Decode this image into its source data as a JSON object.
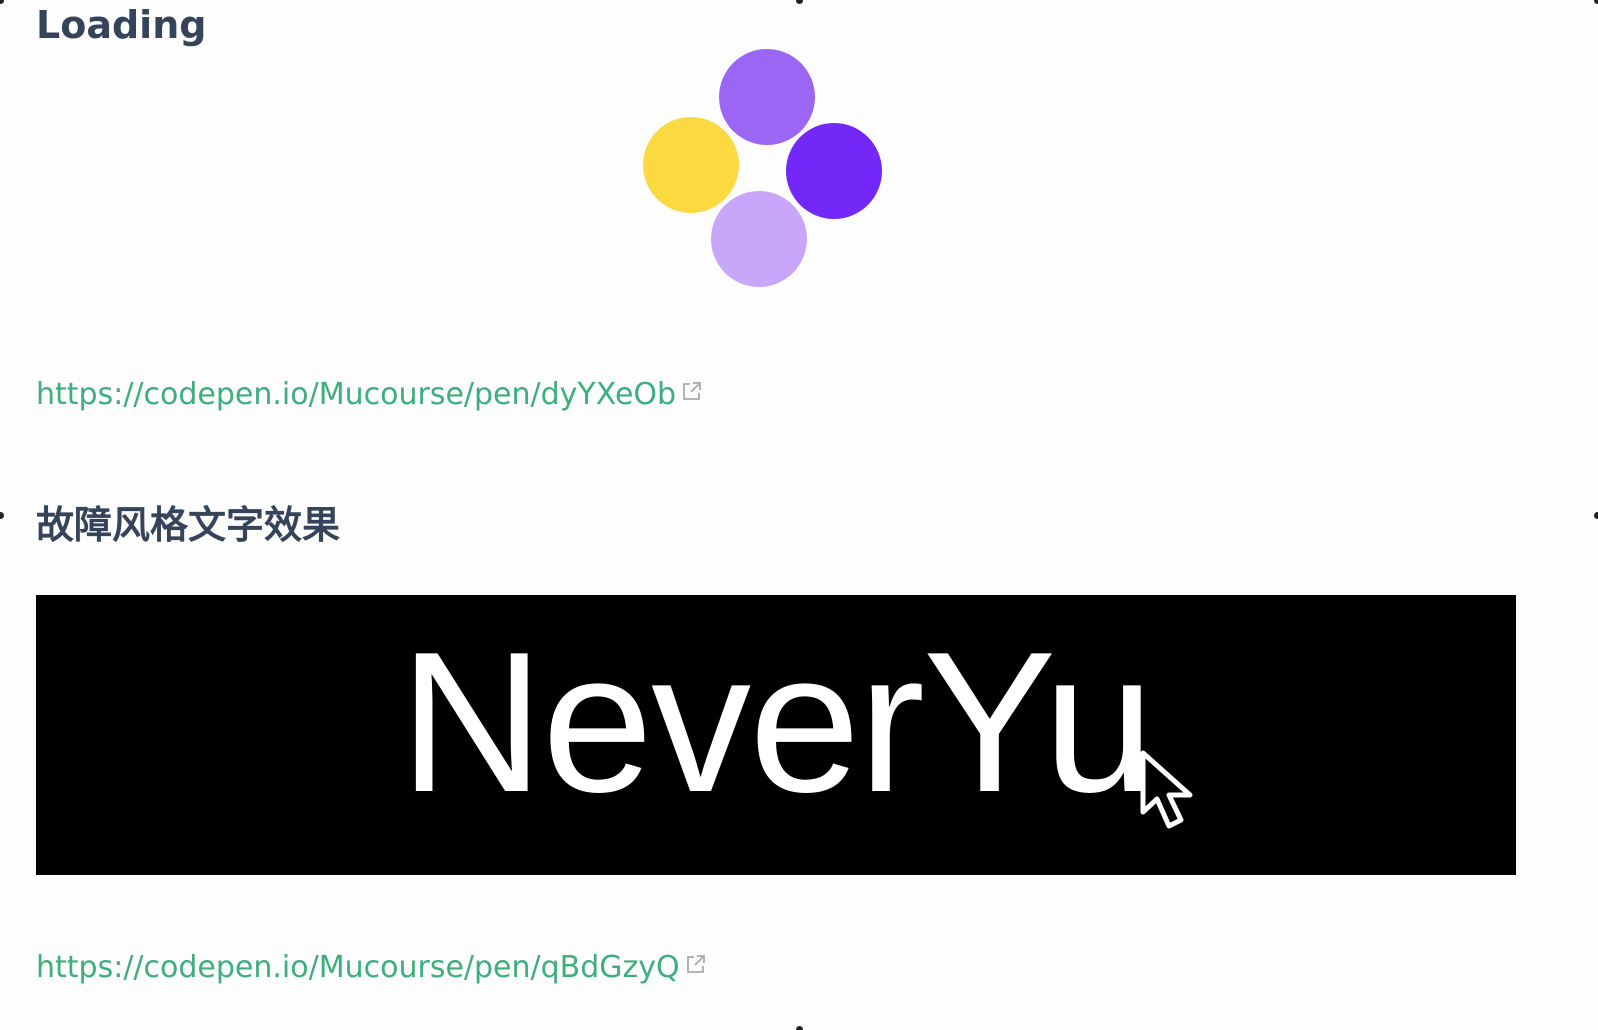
{
  "sections": [
    {
      "title": "Loading",
      "link": "https://codepen.io/Mucourse/pen/dyYXeOb",
      "loader": {
        "dots": [
          {
            "position": "top",
            "color": "#9c66f5"
          },
          {
            "position": "left",
            "color": "#fcd940"
          },
          {
            "position": "right",
            "color": "#7428f7"
          },
          {
            "position": "bottom",
            "color": "#c8a6fa"
          }
        ]
      }
    },
    {
      "title": "故障风格文字效果",
      "link": "https://codepen.io/Mucourse/pen/qBdGzyQ",
      "demo_text": "NeverYu"
    }
  ],
  "colors": {
    "heading": "#36445b",
    "link": "#3eaf7c",
    "external_icon": "#aaaaaa",
    "demo_background": "#000000",
    "demo_text": "#ffffff"
  },
  "icons": {
    "external_link": "external-link-icon",
    "cursor": "mouse-pointer-icon"
  }
}
